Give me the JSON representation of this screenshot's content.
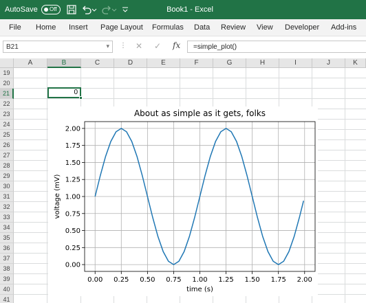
{
  "title_bar": {
    "autosave_label": "AutoSave",
    "autosave_state": "Off",
    "document_title": "Book1  -  Excel",
    "icons": [
      "save-icon",
      "undo-icon",
      "redo-icon",
      "customize-qat-icon"
    ],
    "background_color": "#217346"
  },
  "ribbon": {
    "tabs": [
      "File",
      "Home",
      "Insert",
      "Page Layout",
      "Formulas",
      "Data",
      "Review",
      "View",
      "Developer",
      "Add-ins"
    ]
  },
  "formula_bar": {
    "name_box": "B21",
    "formula": "=simple_plot()",
    "fx_label": "fx"
  },
  "grid": {
    "columns": [
      "A",
      "B",
      "C",
      "D",
      "E",
      "F",
      "G",
      "H",
      "I",
      "J",
      "K"
    ],
    "selected_column": "B",
    "rows": [
      "19",
      "20",
      "21",
      "22",
      "23",
      "24",
      "25",
      "26",
      "27",
      "28",
      "29",
      "30",
      "31",
      "32",
      "33",
      "34",
      "35",
      "36",
      "37",
      "38",
      "39",
      "40",
      "41"
    ],
    "selected_row": "21",
    "active_cell_value": "0",
    "accent_color": "#217346"
  },
  "chart_data": {
    "type": "line",
    "title": "About as simple as it gets, folks",
    "xlabel": "time (s)",
    "ylabel": "voltage (mV)",
    "xlim": [
      -0.1,
      2.1
    ],
    "ylim": [
      -0.1,
      2.1
    ],
    "xticks": [
      "0.00",
      "0.25",
      "0.50",
      "0.75",
      "1.00",
      "1.25",
      "1.50",
      "1.75",
      "2.00"
    ],
    "yticks": [
      "0.00",
      "0.25",
      "0.50",
      "0.75",
      "1.00",
      "1.25",
      "1.50",
      "1.75",
      "2.00"
    ],
    "grid": true,
    "series": [
      {
        "color": "#1f77b4",
        "x": [
          0.0,
          0.05,
          0.1,
          0.15,
          0.2,
          0.25,
          0.3,
          0.35,
          0.4,
          0.45,
          0.5,
          0.55,
          0.6,
          0.65,
          0.7,
          0.75,
          0.8,
          0.85,
          0.9,
          0.95,
          1.0,
          1.05,
          1.1,
          1.15,
          1.2,
          1.25,
          1.3,
          1.35,
          1.4,
          1.45,
          1.5,
          1.55,
          1.6,
          1.65,
          1.7,
          1.75,
          1.8,
          1.85,
          1.9,
          1.95,
          1.99
        ],
        "y": [
          1.0,
          1.309,
          1.588,
          1.809,
          1.951,
          2.0,
          1.951,
          1.809,
          1.588,
          1.309,
          1.0,
          0.691,
          0.412,
          0.191,
          0.049,
          0.0,
          0.049,
          0.191,
          0.412,
          0.691,
          1.0,
          1.309,
          1.588,
          1.809,
          1.951,
          2.0,
          1.951,
          1.809,
          1.588,
          1.309,
          1.0,
          0.691,
          0.412,
          0.191,
          0.049,
          0.0,
          0.049,
          0.191,
          0.412,
          0.691,
          0.937
        ]
      }
    ]
  }
}
